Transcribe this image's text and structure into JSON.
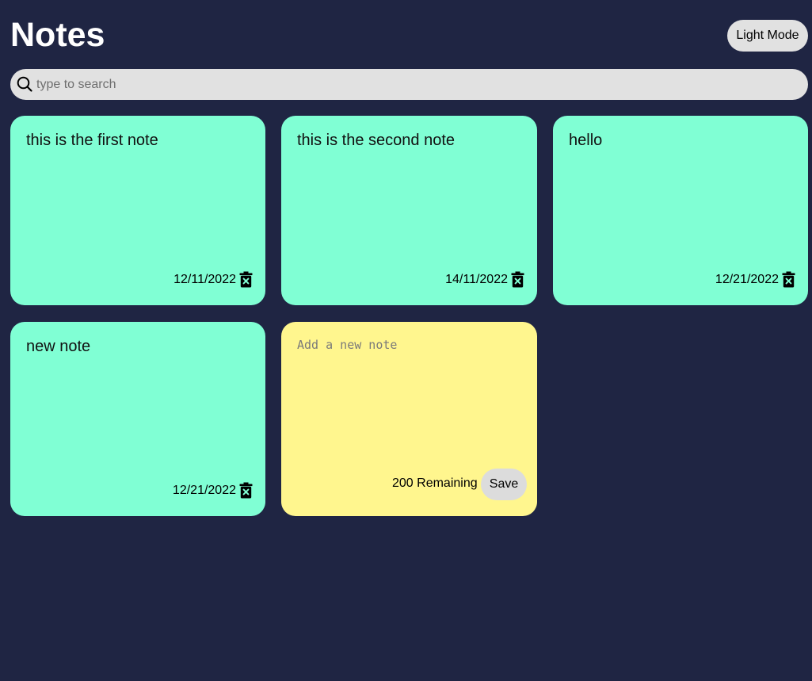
{
  "header": {
    "title": "Notes",
    "theme_toggle_label": "Light Mode"
  },
  "search": {
    "icon": "search-icon",
    "placeholder": "type to search",
    "value": ""
  },
  "notes": [
    {
      "text": "this is the first note",
      "date": "12/11/2022"
    },
    {
      "text": "this is the second note",
      "date": "14/11/2022"
    },
    {
      "text": "hello",
      "date": "12/21/2022"
    },
    {
      "text": "new note",
      "date": "12/21/2022"
    }
  ],
  "new_note": {
    "placeholder": "Add a new note",
    "value": "",
    "remaining_label": "200 Remaining",
    "save_label": "Save"
  },
  "colors": {
    "background": "#1f2543",
    "note": "#80ffd4",
    "new_note": "#fff68e",
    "button": "#e1e1e1"
  }
}
